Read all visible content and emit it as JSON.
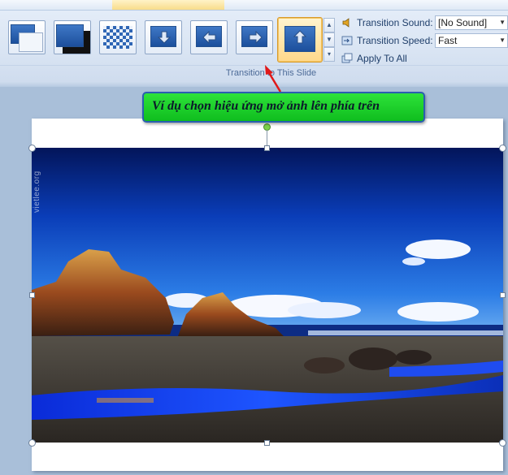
{
  "ribbon": {
    "transitions": [
      {
        "name": "fade-smoothly"
      },
      {
        "name": "fade-through-black"
      },
      {
        "name": "dissolve"
      },
      {
        "name": "wipe-down"
      },
      {
        "name": "wipe-left"
      },
      {
        "name": "wipe-right"
      },
      {
        "name": "wipe-up",
        "selected": true
      }
    ],
    "sound_label": "Transition Sound:",
    "sound_value": "[No Sound]",
    "speed_label": "Transition Speed:",
    "speed_value": "Fast",
    "apply_all_label": "Apply To All",
    "group_label": "Transition to This Slide"
  },
  "callout": {
    "text": "Ví dụ chọn hiệu ứng mở ảnh lên phía trên"
  },
  "slide": {
    "watermark": "vietlee.org"
  },
  "colors": {
    "callout_bg": "#1fd22c",
    "arrow": "#e01818",
    "selected_thumb": "#ffd88a"
  }
}
